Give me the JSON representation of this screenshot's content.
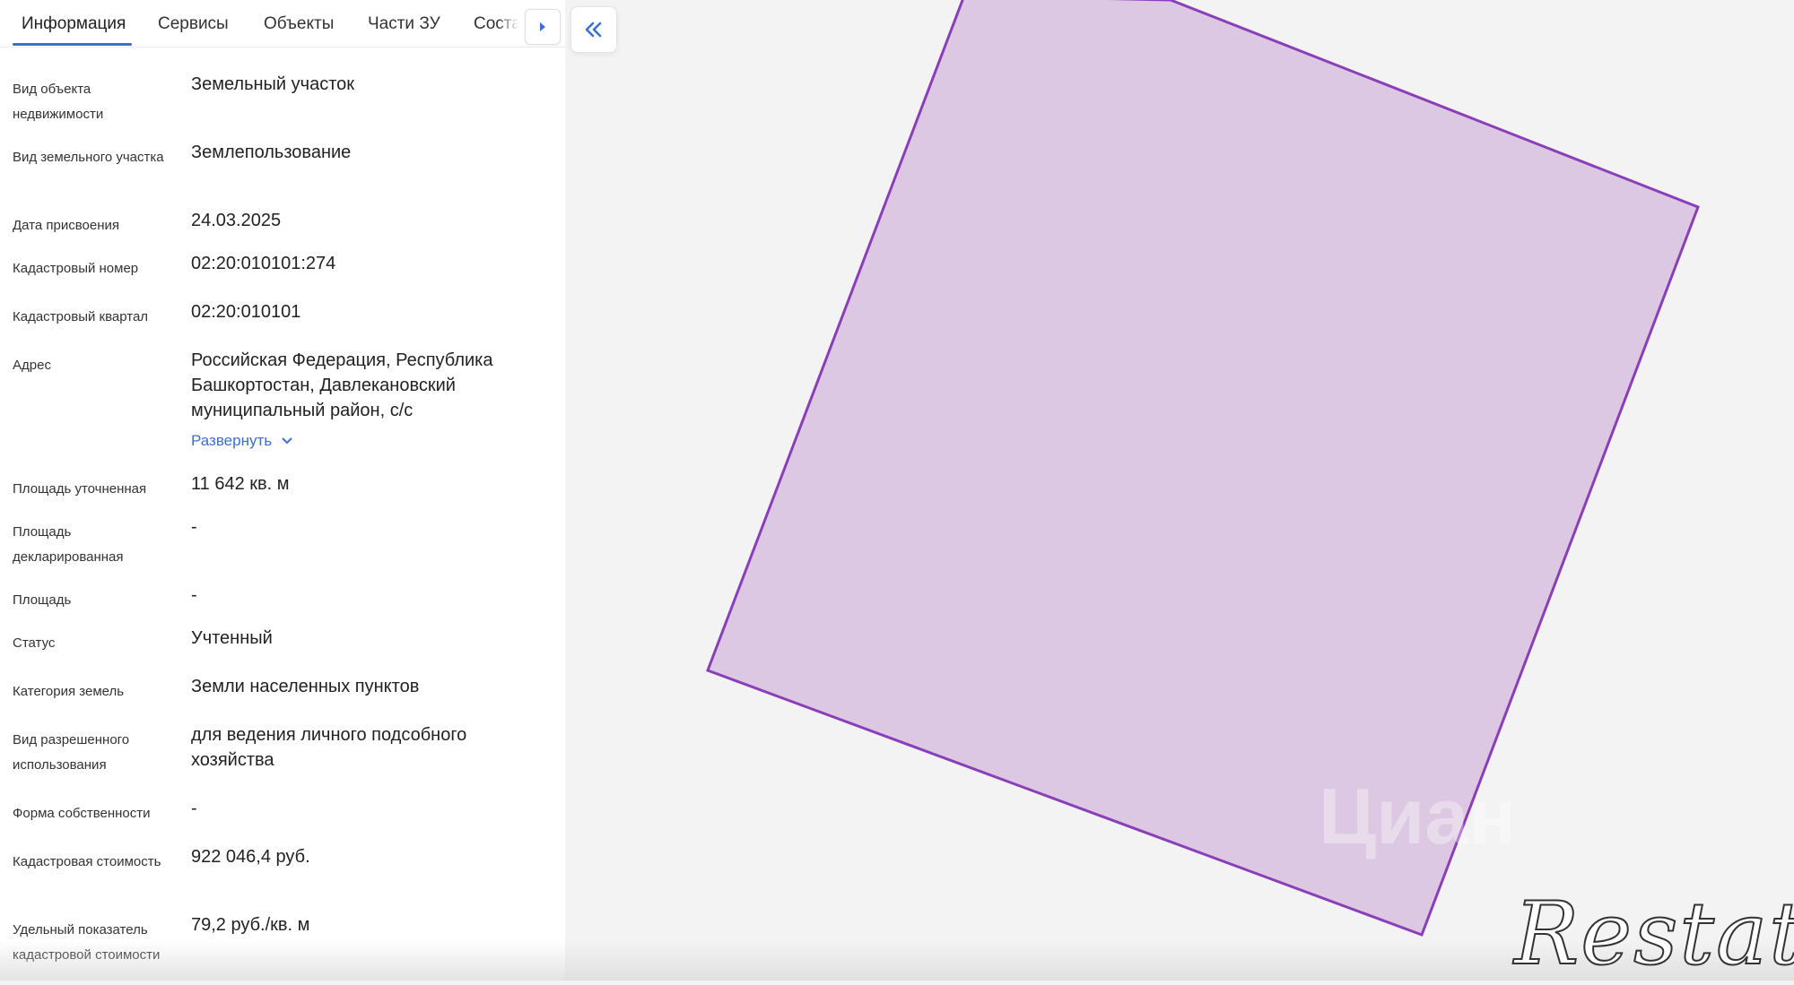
{
  "tabs": [
    {
      "label": "Информация",
      "active": true
    },
    {
      "label": "Сервисы",
      "active": false
    },
    {
      "label": "Объекты",
      "active": false
    },
    {
      "label": "Части ЗУ",
      "active": false
    },
    {
      "label": "Состав",
      "active": false
    }
  ],
  "properties": [
    {
      "label": "Вид объекта недвижимости",
      "value": "Земельный участок"
    },
    {
      "label": "Вид земельного участка",
      "value": "Землепользование"
    },
    {
      "label": "Дата присвоения",
      "value": "24.03.2025"
    },
    {
      "label": "Кадастровый номер",
      "value": "02:20:010101:274"
    },
    {
      "label": "Кадастровый квартал",
      "value": "02:20:010101"
    },
    {
      "label": "Адрес",
      "value": "Российская Федерация, Республика Башкортостан, Давлекановский муниципальный район, с/с"
    },
    {
      "label": "Площадь уточненная",
      "value": "11 642 кв. м"
    },
    {
      "label": "Площадь декларированная",
      "value": "-"
    },
    {
      "label": "Площадь",
      "value": "-"
    },
    {
      "label": "Статус",
      "value": "Учтенный"
    },
    {
      "label": "Категория земель",
      "value": "Земли населенных пунктов"
    },
    {
      "label": "Вид разрешенного использования",
      "value": "для ведения личного подсобного хозяйства"
    },
    {
      "label": "Форма собственности",
      "value": "-"
    },
    {
      "label": "Кадастровая стоимость",
      "value": "922 046,4 руб."
    },
    {
      "label": "Удельный показатель кадастровой стоимости",
      "value": "79,2 руб./кв. м"
    }
  ],
  "address_expand_label": "Развернуть",
  "map": {
    "parcel_fill": "#dcc8e2",
    "parcel_stroke": "#8a3fb8"
  },
  "colors": {
    "accent": "#3b6fd6"
  },
  "watermarks": {
    "cian": "Циан",
    "restate": "Restate"
  }
}
